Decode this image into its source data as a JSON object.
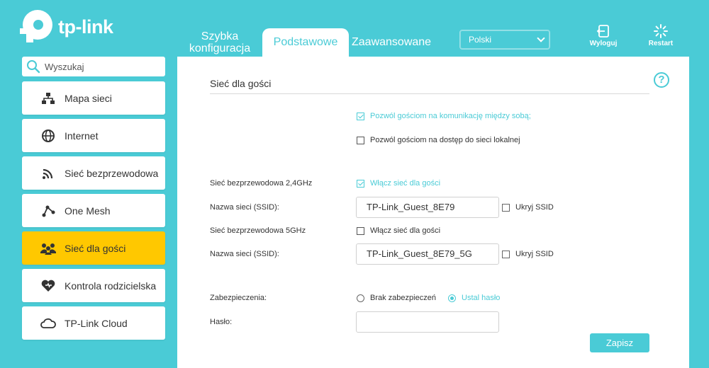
{
  "brand": {
    "logo_text": "tp-link"
  },
  "header": {
    "tabs": [
      {
        "label": "Szybka konfiguracja"
      },
      {
        "label": "Podstawowe",
        "active": true
      },
      {
        "label": "Zaawansowane"
      }
    ],
    "language": {
      "selected": "Polski"
    },
    "logout_label": "Wyloguj",
    "restart_label": "Restart"
  },
  "sidebar": {
    "search": {
      "placeholder": "Wyszukaj"
    },
    "items": [
      {
        "label": "Mapa sieci",
        "icon": "network-map-icon"
      },
      {
        "label": "Internet",
        "icon": "globe-icon"
      },
      {
        "label": "Sieć bezprzewodowa",
        "icon": "wireless-icon"
      },
      {
        "label": "One Mesh",
        "icon": "mesh-icon"
      },
      {
        "label": "Sieć dla gości",
        "icon": "guests-icon",
        "active": true
      },
      {
        "label": "Kontrola rodzicielska",
        "icon": "parental-heart-icon"
      },
      {
        "label": "TP-Link Cloud",
        "icon": "cloud-icon"
      }
    ]
  },
  "main": {
    "title": "Sieć dla gości",
    "allow_guests_communicate": {
      "label": "Pozwól gościom na komunikację między sobą;",
      "checked": true
    },
    "allow_local_access": {
      "label": "Pozwól gościom na dostęp do sieci lokalnej",
      "checked": false
    },
    "band_24": {
      "label": "Sieć bezprzewodowa 2,4GHz",
      "enable_label": "Włącz sieć dla gości",
      "enabled": true,
      "ssid_label": "Nazwa sieci (SSID):",
      "ssid_value": "TP-Link_Guest_8E79",
      "hide_label": "Ukryj SSID",
      "hidden": false
    },
    "band_5": {
      "label": "Sieć bezprzewodowa 5GHz",
      "enable_label": "Włącz sieć dla gości",
      "enabled": false,
      "ssid_label": "Nazwa sieci (SSID):",
      "ssid_value": "TP-Link_Guest_8E79_5G",
      "hide_label": "Ukryj SSID",
      "hidden": false
    },
    "security": {
      "label": "Zabezpieczenia:",
      "options": [
        {
          "label": "Brak zabezpieczeń",
          "selected": false
        },
        {
          "label": "Ustal hasło",
          "selected": true
        }
      ]
    },
    "password": {
      "label": "Hasło:",
      "value": ""
    },
    "save_label": "Zapisz"
  },
  "colors": {
    "accent": "#4acbd6",
    "active_nav": "#ffc800"
  }
}
